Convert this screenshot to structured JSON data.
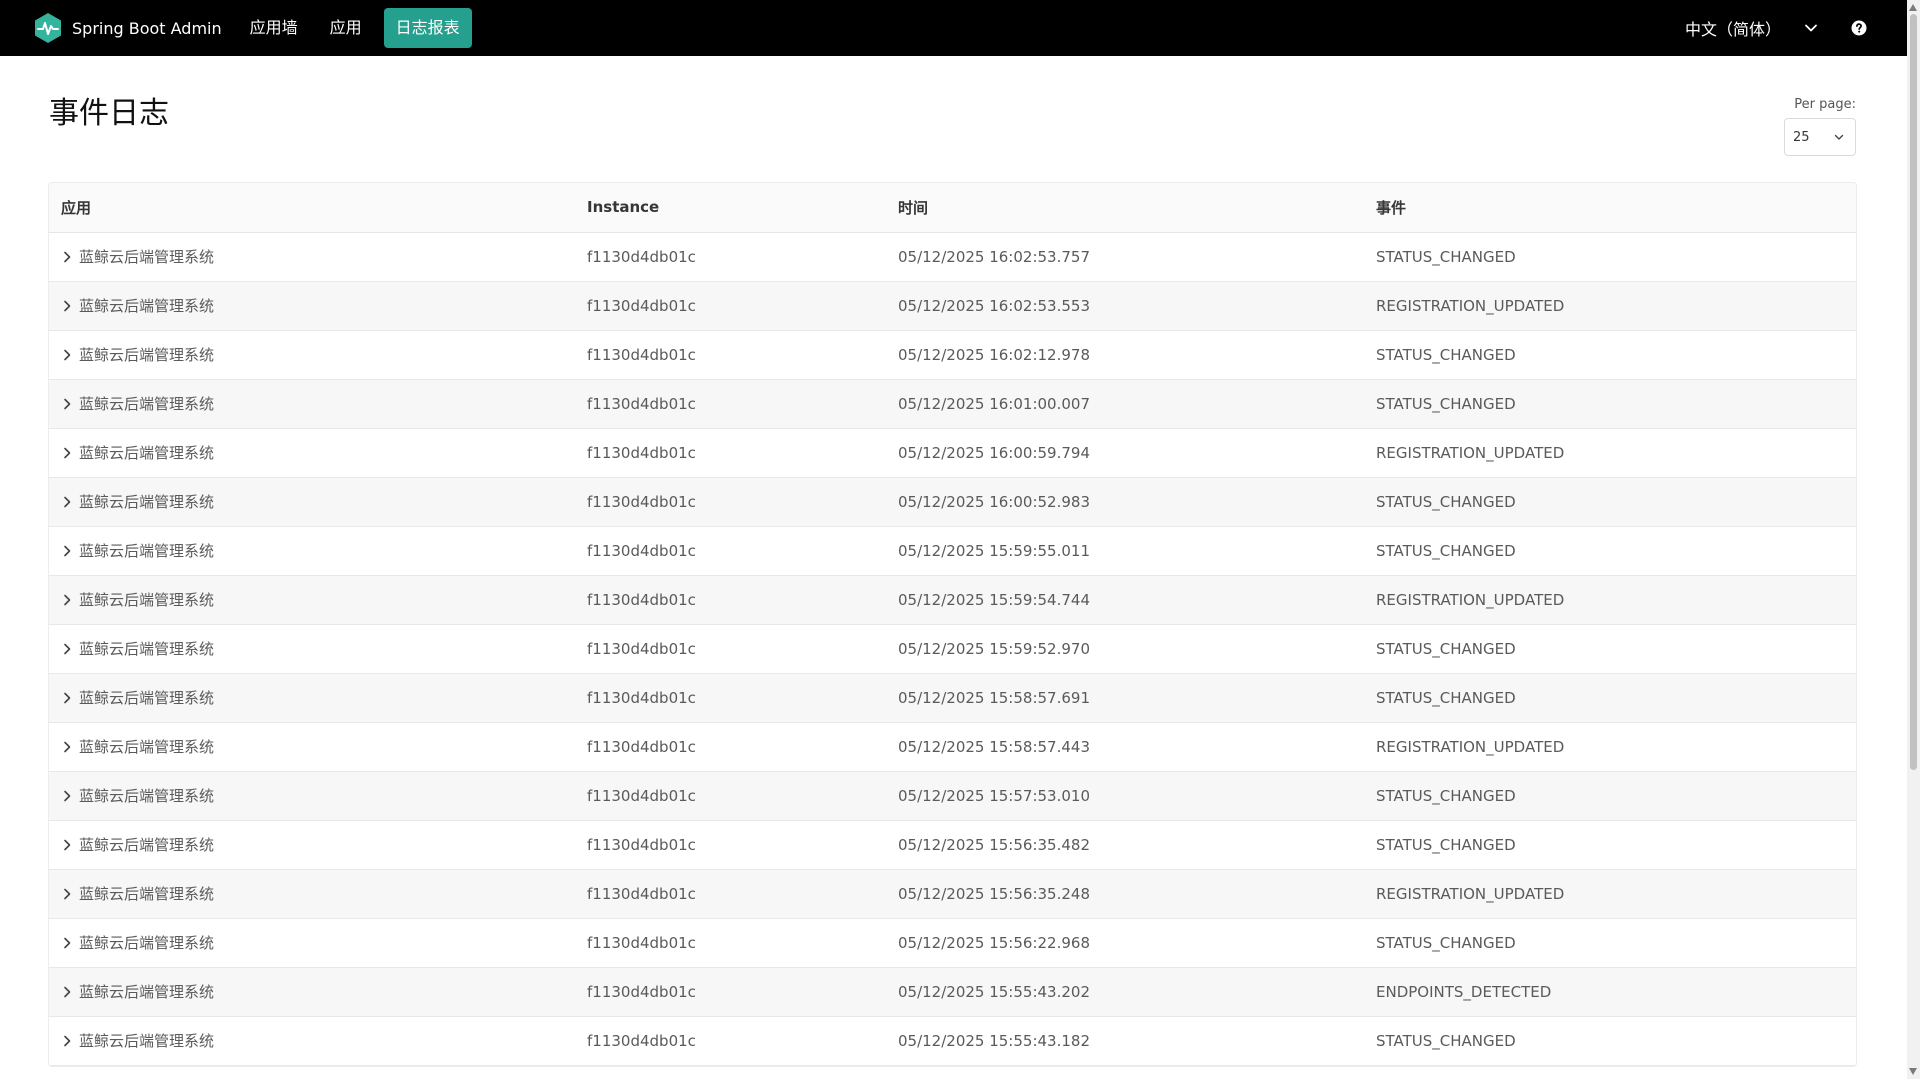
{
  "navbar": {
    "brand": "Spring Boot Admin",
    "items": [
      {
        "label": "应用墙"
      },
      {
        "label": "应用"
      },
      {
        "label": "日志报表",
        "active": true
      }
    ],
    "language": "中文（简体）",
    "accent_color": "#26a08e"
  },
  "page": {
    "title": "事件日志",
    "per_page_label": "Per page:",
    "per_page_value": "25"
  },
  "table": {
    "columns": [
      "应用",
      "Instance",
      "时间",
      "事件"
    ],
    "rows": [
      {
        "app": "蓝鲸云后端管理系统",
        "instance": "f1130d4db01c",
        "time": "05/12/2025 16:02:53.757",
        "event": "STATUS_CHANGED"
      },
      {
        "app": "蓝鲸云后端管理系统",
        "instance": "f1130d4db01c",
        "time": "05/12/2025 16:02:53.553",
        "event": "REGISTRATION_UPDATED"
      },
      {
        "app": "蓝鲸云后端管理系统",
        "instance": "f1130d4db01c",
        "time": "05/12/2025 16:02:12.978",
        "event": "STATUS_CHANGED"
      },
      {
        "app": "蓝鲸云后端管理系统",
        "instance": "f1130d4db01c",
        "time": "05/12/2025 16:01:00.007",
        "event": "STATUS_CHANGED"
      },
      {
        "app": "蓝鲸云后端管理系统",
        "instance": "f1130d4db01c",
        "time": "05/12/2025 16:00:59.794",
        "event": "REGISTRATION_UPDATED"
      },
      {
        "app": "蓝鲸云后端管理系统",
        "instance": "f1130d4db01c",
        "time": "05/12/2025 16:00:52.983",
        "event": "STATUS_CHANGED"
      },
      {
        "app": "蓝鲸云后端管理系统",
        "instance": "f1130d4db01c",
        "time": "05/12/2025 15:59:55.011",
        "event": "STATUS_CHANGED"
      },
      {
        "app": "蓝鲸云后端管理系统",
        "instance": "f1130d4db01c",
        "time": "05/12/2025 15:59:54.744",
        "event": "REGISTRATION_UPDATED"
      },
      {
        "app": "蓝鲸云后端管理系统",
        "instance": "f1130d4db01c",
        "time": "05/12/2025 15:59:52.970",
        "event": "STATUS_CHANGED"
      },
      {
        "app": "蓝鲸云后端管理系统",
        "instance": "f1130d4db01c",
        "time": "05/12/2025 15:58:57.691",
        "event": "STATUS_CHANGED"
      },
      {
        "app": "蓝鲸云后端管理系统",
        "instance": "f1130d4db01c",
        "time": "05/12/2025 15:58:57.443",
        "event": "REGISTRATION_UPDATED"
      },
      {
        "app": "蓝鲸云后端管理系统",
        "instance": "f1130d4db01c",
        "time": "05/12/2025 15:57:53.010",
        "event": "STATUS_CHANGED"
      },
      {
        "app": "蓝鲸云后端管理系统",
        "instance": "f1130d4db01c",
        "time": "05/12/2025 15:56:35.482",
        "event": "STATUS_CHANGED"
      },
      {
        "app": "蓝鲸云后端管理系统",
        "instance": "f1130d4db01c",
        "time": "05/12/2025 15:56:35.248",
        "event": "REGISTRATION_UPDATED"
      },
      {
        "app": "蓝鲸云后端管理系统",
        "instance": "f1130d4db01c",
        "time": "05/12/2025 15:56:22.968",
        "event": "STATUS_CHANGED"
      },
      {
        "app": "蓝鲸云后端管理系统",
        "instance": "f1130d4db01c",
        "time": "05/12/2025 15:55:43.202",
        "event": "ENDPOINTS_DETECTED"
      },
      {
        "app": "蓝鲸云后端管理系统",
        "instance": "f1130d4db01c",
        "time": "05/12/2025 15:55:43.182",
        "event": "STATUS_CHANGED"
      }
    ]
  }
}
